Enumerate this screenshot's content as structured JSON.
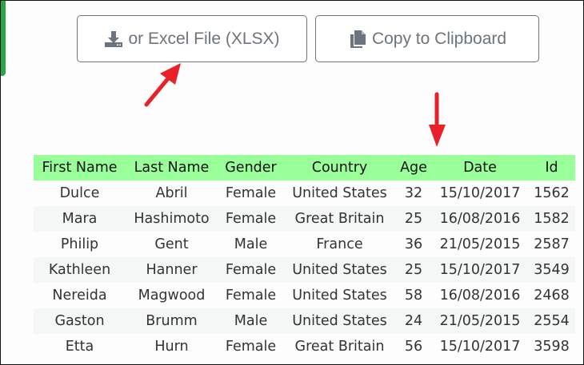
{
  "toolbar": {
    "excel_label": "or Excel File (XLSX)",
    "excel_icon": "download-icon",
    "copy_label": "Copy to Clipboard",
    "copy_icon": "copy-icon"
  },
  "table": {
    "headers": [
      "First Name",
      "Last Name",
      "Gender",
      "Country",
      "Age",
      "Date",
      "Id"
    ],
    "rows": [
      [
        "Dulce",
        "Abril",
        "Female",
        "United States",
        "32",
        "15/10/2017",
        "1562"
      ],
      [
        "Mara",
        "Hashimoto",
        "Female",
        "Great Britain",
        "25",
        "16/08/2016",
        "1582"
      ],
      [
        "Philip",
        "Gent",
        "Male",
        "France",
        "36",
        "21/05/2015",
        "2587"
      ],
      [
        "Kathleen",
        "Hanner",
        "Female",
        "United States",
        "25",
        "15/10/2017",
        "3549"
      ],
      [
        "Nereida",
        "Magwood",
        "Female",
        "United States",
        "58",
        "16/08/2016",
        "2468"
      ],
      [
        "Gaston",
        "Brumm",
        "Male",
        "United States",
        "24",
        "21/05/2015",
        "2554"
      ],
      [
        "Etta",
        "Hurn",
        "Female",
        "Great Britain",
        "56",
        "15/10/2017",
        "3598"
      ]
    ]
  },
  "colors": {
    "header_bg": "#99ff99",
    "annotation": "#e8202a",
    "accent": "#28a745"
  }
}
